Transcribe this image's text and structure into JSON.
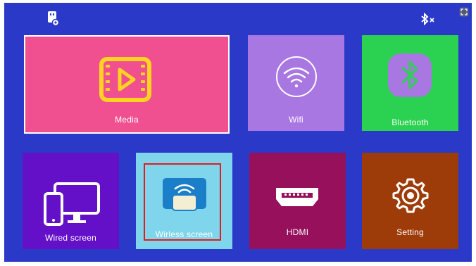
{
  "status_bar": {
    "left_icon": "usb-drive-icon",
    "right_icons": [
      "bluetooth-off-icon",
      "fullscreen-icon"
    ]
  },
  "tiles": [
    {
      "id": "media",
      "label": "Media",
      "icon": "video-play-icon",
      "color": "#f0508f"
    },
    {
      "id": "wifi",
      "label": "Wifi",
      "icon": "wifi-icon",
      "color": "#a977e2"
    },
    {
      "id": "bluetooth",
      "label": "Bluetooth",
      "icon": "bluetooth-icon",
      "color": "#2bd150"
    },
    {
      "id": "wired",
      "label": "Wired screen",
      "icon": "phone-monitor-icon",
      "color": "#6410c8"
    },
    {
      "id": "wireless",
      "label": "Wirless screen",
      "icon": "wireless-cast-icon",
      "color": "#7fd6ec"
    },
    {
      "id": "hdmi",
      "label": "HDMI",
      "icon": "hdmi-port-icon",
      "color": "#96105c"
    },
    {
      "id": "setting",
      "label": "Setting",
      "icon": "gear-icon",
      "color": "#9e3c09"
    }
  ],
  "colors": {
    "background": "#2b39c8",
    "selection_outline": "#e21b1b",
    "label_text": "#ffffff"
  }
}
